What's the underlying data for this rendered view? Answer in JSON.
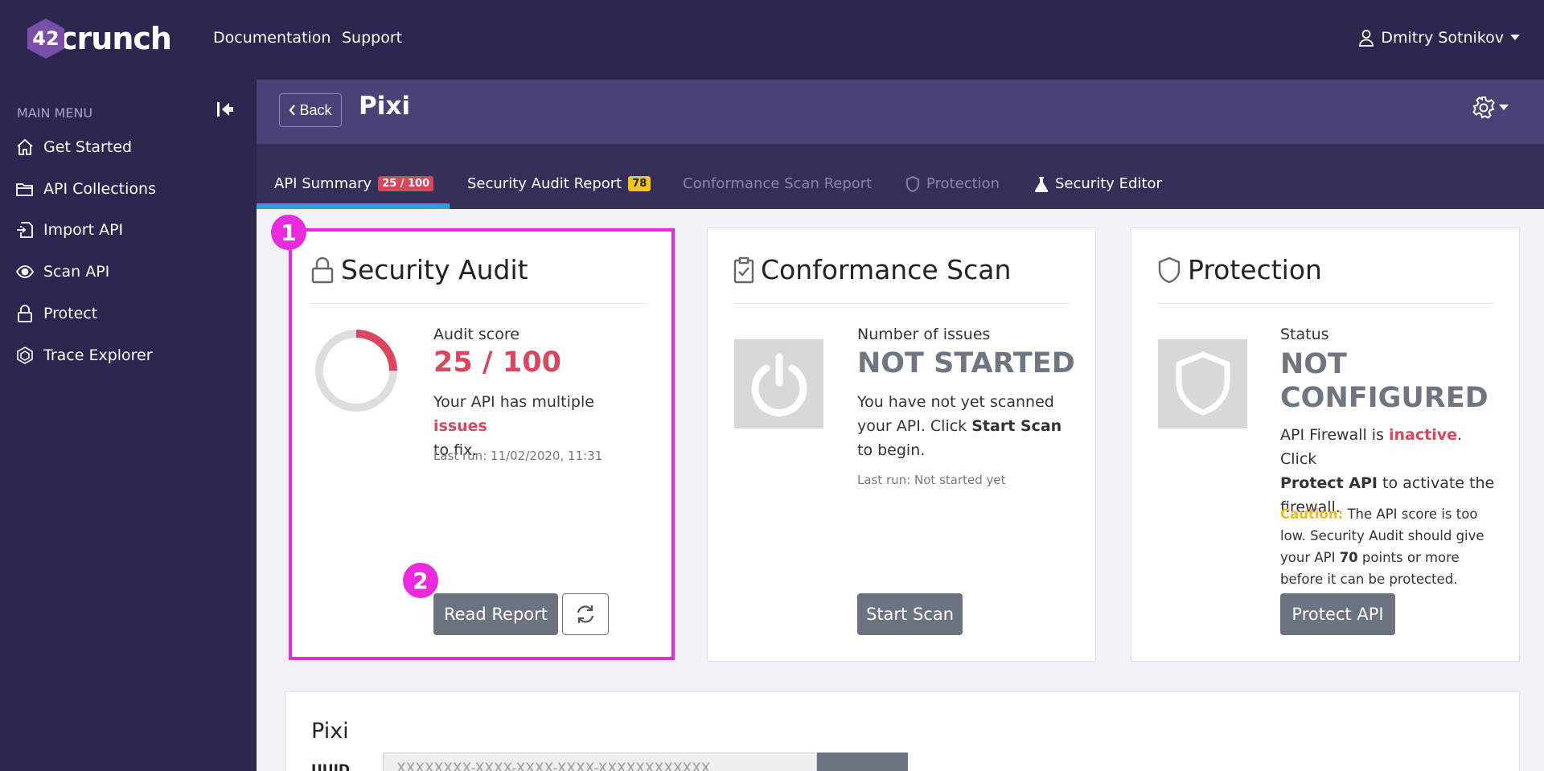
{
  "brand": {
    "logo_num": "42",
    "logo_word": "crunch"
  },
  "topnav": {
    "links": [
      "Documentation",
      "Support"
    ],
    "user": "Dmitry Sotnikov"
  },
  "sidebar": {
    "title": "MAIN MENU",
    "items": [
      {
        "label": "Get Started",
        "icon": "home-icon"
      },
      {
        "label": "API Collections",
        "icon": "folder-icon"
      },
      {
        "label": "Import API",
        "icon": "import-icon"
      },
      {
        "label": "Scan API",
        "icon": "eye-icon"
      },
      {
        "label": "Protect",
        "icon": "lock-icon"
      },
      {
        "label": "Trace Explorer",
        "icon": "hexagon-icon"
      }
    ]
  },
  "header": {
    "back_label": "Back",
    "title": "Pixi"
  },
  "tabs": [
    {
      "label": "API Summary",
      "badge": "25 / 100"
    },
    {
      "label": "Security Audit Report",
      "badge": "78"
    },
    {
      "label": "Conformance Scan Report"
    },
    {
      "label": "Protection"
    },
    {
      "label": "Security Editor"
    }
  ],
  "audit": {
    "title": "Security Audit",
    "score_label": "Audit score",
    "score": "25 / 100",
    "score_fraction": 0.25,
    "desc_pre": "Your API has multiple",
    "desc_link": "issues",
    "desc_post": "to fix.",
    "last_run": "Last run: 11/02/2020, 11:31",
    "read_report": "Read Report"
  },
  "scan": {
    "title": "Conformance Scan",
    "label": "Number of issues",
    "status": "NOT STARTED",
    "desc_pre": "You have not yet scanned your API. Click",
    "desc_bold": "Start Scan",
    "desc_post": "to begin.",
    "last_run": "Last run: Not started yet",
    "button": "Start Scan"
  },
  "protection": {
    "title": "Protection",
    "label": "Status",
    "status_line1": "NOT",
    "status_line2": "CONFIGURED",
    "desc1": "API Firewall is",
    "desc_inactive": "inactive",
    "desc2": ". Click",
    "desc_bold": "Protect API",
    "desc3": "to activate the firewall.",
    "caution_label": "Caution:",
    "caution1": "The API score is too low. Security Audit should give your API",
    "caution_bold": "70",
    "caution2": "points or more before it can be protected.",
    "button": "Protect API"
  },
  "markers": [
    "1",
    "2"
  ],
  "bottom": {
    "title": "Pixi",
    "uuid_label": "UUID",
    "uuid_value": "XXXXXXXX-XXXX-XXXX-XXXX-XXXXXXXXXXXX"
  },
  "colors": {
    "nav": "#2d2750",
    "accent_red": "#d9465e",
    "highlight": "#ea2bdd",
    "tab_underline": "#29a3e0"
  }
}
